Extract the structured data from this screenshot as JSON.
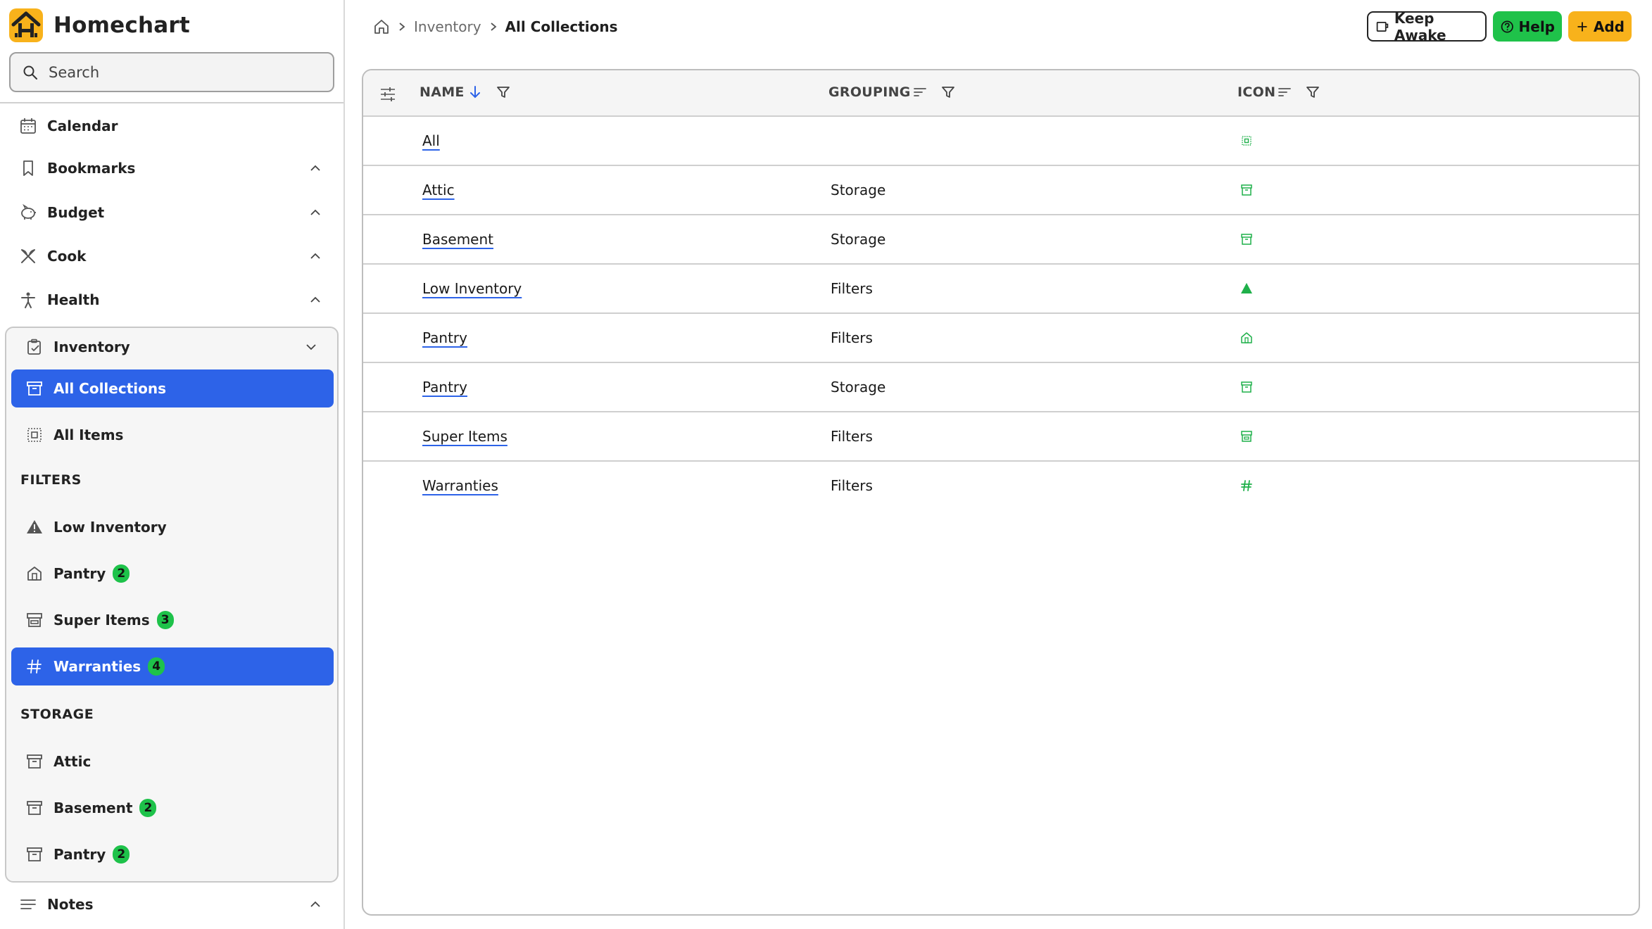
{
  "app": {
    "title": "Homechart",
    "accent": "#2d63e8",
    "badge_color": "#1ec24a",
    "icon_color": "#1fb04a"
  },
  "search": {
    "placeholder": "Search"
  },
  "nav": [
    {
      "label": "Calendar",
      "icon": "calendar-icon"
    },
    {
      "label": "Bookmarks",
      "icon": "bookmark-icon"
    },
    {
      "label": "Budget",
      "icon": "piggy-bank-icon"
    },
    {
      "label": "Cook",
      "icon": "utensils-icon"
    },
    {
      "label": "Health",
      "icon": "person-icon"
    }
  ],
  "inventory": {
    "label": "Inventory",
    "items": [
      {
        "label": "All Collections",
        "icon": "archive-icon",
        "active": true
      },
      {
        "label": "All Items",
        "icon": "grid-icon",
        "active": false
      }
    ],
    "filters_heading": "FILTERS",
    "filters": [
      {
        "label": "Low Inventory",
        "icon": "warning-icon",
        "badge": ""
      },
      {
        "label": "Pantry",
        "icon": "house-icon",
        "badge": "2"
      },
      {
        "label": "Super Items",
        "icon": "store-icon",
        "badge": "3"
      },
      {
        "label": "Warranties",
        "icon": "hash-icon",
        "badge": "4",
        "active": true
      }
    ],
    "storage_heading": "STORAGE",
    "storage": [
      {
        "label": "Attic",
        "icon": "archive-icon",
        "badge": ""
      },
      {
        "label": "Basement",
        "icon": "archive-icon",
        "badge": "2"
      },
      {
        "label": "Pantry",
        "icon": "archive-icon",
        "badge": "2"
      }
    ]
  },
  "notes": {
    "label": "Notes"
  },
  "breadcrumb": {
    "crumb": "Inventory",
    "current": "All Collections"
  },
  "toolbar": {
    "keep_awake": "Keep Awake",
    "help": "Help",
    "add": "Add"
  },
  "table": {
    "columns": {
      "name": "NAME",
      "grouping": "GROUPING",
      "icon": "ICON"
    },
    "rows": [
      {
        "name": "All",
        "grouping": "",
        "icon": "grid-icon"
      },
      {
        "name": "Attic",
        "grouping": "Storage",
        "icon": "archive-icon"
      },
      {
        "name": "Basement",
        "grouping": "Storage",
        "icon": "archive-icon"
      },
      {
        "name": "Low Inventory",
        "grouping": "Filters",
        "icon": "warning-icon"
      },
      {
        "name": "Pantry",
        "grouping": "Filters",
        "icon": "house-icon"
      },
      {
        "name": "Pantry",
        "grouping": "Storage",
        "icon": "archive-icon"
      },
      {
        "name": "Super Items",
        "grouping": "Filters",
        "icon": "store-icon"
      },
      {
        "name": "Warranties",
        "grouping": "Filters",
        "icon": "hash-icon"
      }
    ]
  }
}
